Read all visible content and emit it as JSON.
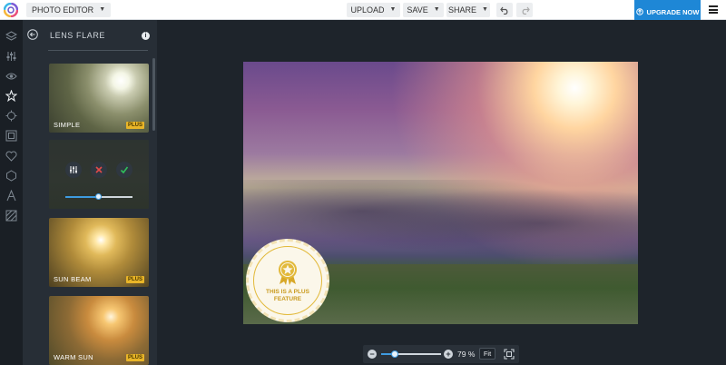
{
  "topbar": {
    "mode_label": "PHOTO EDITOR",
    "upload_label": "UPLOAD",
    "save_label": "SAVE",
    "share_label": "SHARE",
    "upgrade_label": "UPGRADE NOW"
  },
  "rail": {
    "icons": [
      "layers-icon",
      "adjust-sliders-icon",
      "eye-icon",
      "star-icon",
      "effects-icon",
      "frame-icon",
      "heart-icon",
      "shape-icon",
      "text-icon",
      "texture-icon"
    ]
  },
  "panel": {
    "title": "LENS FLARE",
    "tiles": [
      {
        "label": "SIMPLE",
        "badge": "PLUS"
      },
      {
        "label": "",
        "badge": "",
        "slider_value": 0.5
      },
      {
        "label": "SUN BEAM",
        "badge": "PLUS"
      },
      {
        "label": "WARM SUN",
        "badge": "PLUS"
      }
    ]
  },
  "seal": {
    "text": "THIS IS A PLUS FEATURE"
  },
  "zoom": {
    "percent_label": "79 %",
    "fit_label": "Fit",
    "slider_value": 0.22
  },
  "colors": {
    "accent": "#1e87d6",
    "badge": "#e9b528",
    "confirm": "#2fbf5b",
    "cancel": "#e24a4a"
  }
}
